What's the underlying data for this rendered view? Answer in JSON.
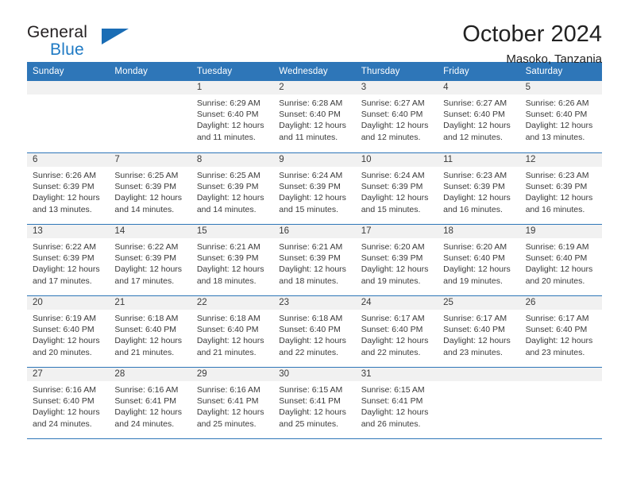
{
  "logo": {
    "word_one": "General",
    "word_two": "Blue",
    "triangle_color": "#1a6db5"
  },
  "header": {
    "title": "October 2024",
    "subtitle": "Masoko, Tanzania"
  },
  "theme": {
    "header_blue": "#2e76b8",
    "day_strip_gray": "#f1f1f1",
    "text_gray": "#3a3a3a"
  },
  "weekdays": [
    "Sunday",
    "Monday",
    "Tuesday",
    "Wednesday",
    "Thursday",
    "Friday",
    "Saturday"
  ],
  "weeks": [
    [
      {
        "day": "",
        "info": ""
      },
      {
        "day": "",
        "info": ""
      },
      {
        "day": "1",
        "info": "Sunrise: 6:29 AM\nSunset: 6:40 PM\nDaylight: 12 hours\nand 11 minutes."
      },
      {
        "day": "2",
        "info": "Sunrise: 6:28 AM\nSunset: 6:40 PM\nDaylight: 12 hours\nand 11 minutes."
      },
      {
        "day": "3",
        "info": "Sunrise: 6:27 AM\nSunset: 6:40 PM\nDaylight: 12 hours\nand 12 minutes."
      },
      {
        "day": "4",
        "info": "Sunrise: 6:27 AM\nSunset: 6:40 PM\nDaylight: 12 hours\nand 12 minutes."
      },
      {
        "day": "5",
        "info": "Sunrise: 6:26 AM\nSunset: 6:40 PM\nDaylight: 12 hours\nand 13 minutes."
      }
    ],
    [
      {
        "day": "6",
        "info": "Sunrise: 6:26 AM\nSunset: 6:39 PM\nDaylight: 12 hours\nand 13 minutes."
      },
      {
        "day": "7",
        "info": "Sunrise: 6:25 AM\nSunset: 6:39 PM\nDaylight: 12 hours\nand 14 minutes."
      },
      {
        "day": "8",
        "info": "Sunrise: 6:25 AM\nSunset: 6:39 PM\nDaylight: 12 hours\nand 14 minutes."
      },
      {
        "day": "9",
        "info": "Sunrise: 6:24 AM\nSunset: 6:39 PM\nDaylight: 12 hours\nand 15 minutes."
      },
      {
        "day": "10",
        "info": "Sunrise: 6:24 AM\nSunset: 6:39 PM\nDaylight: 12 hours\nand 15 minutes."
      },
      {
        "day": "11",
        "info": "Sunrise: 6:23 AM\nSunset: 6:39 PM\nDaylight: 12 hours\nand 16 minutes."
      },
      {
        "day": "12",
        "info": "Sunrise: 6:23 AM\nSunset: 6:39 PM\nDaylight: 12 hours\nand 16 minutes."
      }
    ],
    [
      {
        "day": "13",
        "info": "Sunrise: 6:22 AM\nSunset: 6:39 PM\nDaylight: 12 hours\nand 17 minutes."
      },
      {
        "day": "14",
        "info": "Sunrise: 6:22 AM\nSunset: 6:39 PM\nDaylight: 12 hours\nand 17 minutes."
      },
      {
        "day": "15",
        "info": "Sunrise: 6:21 AM\nSunset: 6:39 PM\nDaylight: 12 hours\nand 18 minutes."
      },
      {
        "day": "16",
        "info": "Sunrise: 6:21 AM\nSunset: 6:39 PM\nDaylight: 12 hours\nand 18 minutes."
      },
      {
        "day": "17",
        "info": "Sunrise: 6:20 AM\nSunset: 6:39 PM\nDaylight: 12 hours\nand 19 minutes."
      },
      {
        "day": "18",
        "info": "Sunrise: 6:20 AM\nSunset: 6:40 PM\nDaylight: 12 hours\nand 19 minutes."
      },
      {
        "day": "19",
        "info": "Sunrise: 6:19 AM\nSunset: 6:40 PM\nDaylight: 12 hours\nand 20 minutes."
      }
    ],
    [
      {
        "day": "20",
        "info": "Sunrise: 6:19 AM\nSunset: 6:40 PM\nDaylight: 12 hours\nand 20 minutes."
      },
      {
        "day": "21",
        "info": "Sunrise: 6:18 AM\nSunset: 6:40 PM\nDaylight: 12 hours\nand 21 minutes."
      },
      {
        "day": "22",
        "info": "Sunrise: 6:18 AM\nSunset: 6:40 PM\nDaylight: 12 hours\nand 21 minutes."
      },
      {
        "day": "23",
        "info": "Sunrise: 6:18 AM\nSunset: 6:40 PM\nDaylight: 12 hours\nand 22 minutes."
      },
      {
        "day": "24",
        "info": "Sunrise: 6:17 AM\nSunset: 6:40 PM\nDaylight: 12 hours\nand 22 minutes."
      },
      {
        "day": "25",
        "info": "Sunrise: 6:17 AM\nSunset: 6:40 PM\nDaylight: 12 hours\nand 23 minutes."
      },
      {
        "day": "26",
        "info": "Sunrise: 6:17 AM\nSunset: 6:40 PM\nDaylight: 12 hours\nand 23 minutes."
      }
    ],
    [
      {
        "day": "27",
        "info": "Sunrise: 6:16 AM\nSunset: 6:40 PM\nDaylight: 12 hours\nand 24 minutes."
      },
      {
        "day": "28",
        "info": "Sunrise: 6:16 AM\nSunset: 6:41 PM\nDaylight: 12 hours\nand 24 minutes."
      },
      {
        "day": "29",
        "info": "Sunrise: 6:16 AM\nSunset: 6:41 PM\nDaylight: 12 hours\nand 25 minutes."
      },
      {
        "day": "30",
        "info": "Sunrise: 6:15 AM\nSunset: 6:41 PM\nDaylight: 12 hours\nand 25 minutes."
      },
      {
        "day": "31",
        "info": "Sunrise: 6:15 AM\nSunset: 6:41 PM\nDaylight: 12 hours\nand 26 minutes."
      },
      {
        "day": "",
        "info": ""
      },
      {
        "day": "",
        "info": ""
      }
    ]
  ]
}
